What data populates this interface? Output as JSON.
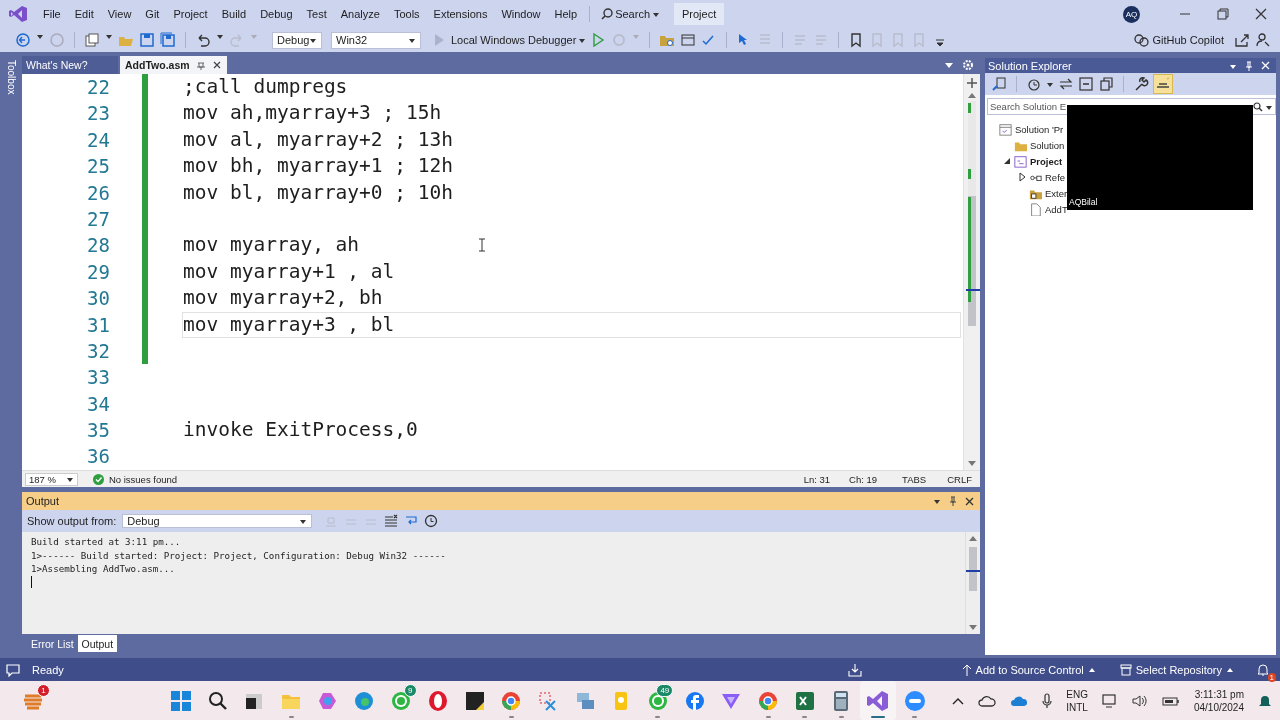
{
  "window": {
    "title": "Project",
    "user_initials": "AQ"
  },
  "menu": [
    "File",
    "Edit",
    "View",
    "Git",
    "Project",
    "Build",
    "Debug",
    "Test",
    "Analyze",
    "Tools",
    "Extensions",
    "Window",
    "Help"
  ],
  "search": {
    "label": "Search"
  },
  "toolbar": {
    "configuration": "Debug",
    "platform": "Win32",
    "debugger": "Local Windows Debugger",
    "copilot": "GitHub Copilot"
  },
  "toolbox": {
    "label": "Toolbox"
  },
  "editor_tabs": [
    {
      "label": "What's New?",
      "selected": false
    },
    {
      "label": "AddTwo.asm",
      "selected": true
    }
  ],
  "code_lines": [
    {
      "number": "22",
      "text": ";call dumpregs",
      "modified": true,
      "current": false
    },
    {
      "number": "23",
      "text": "mov ah,myarray+3 ; 15h",
      "modified": true,
      "current": false
    },
    {
      "number": "24",
      "text": "mov al, myarray+2 ; 13h",
      "modified": true,
      "current": false
    },
    {
      "number": "25",
      "text": "mov bh, myarray+1 ; 12h",
      "modified": true,
      "current": false
    },
    {
      "number": "26",
      "text": "mov bl, myarray+0 ; 10h",
      "modified": true,
      "current": false
    },
    {
      "number": "27",
      "modified": true,
      "current": false
    },
    {
      "number": "28",
      "text": "mov myarray, ah",
      "modified": true,
      "current": false
    },
    {
      "number": "29",
      "text": "mov myarray+1 , al",
      "modified": true,
      "current": false
    },
    {
      "number": "30",
      "text": "mov myarray+2, bh",
      "modified": true,
      "current": false
    },
    {
      "number": "31",
      "text": "mov myarray+3 , bl",
      "modified": true,
      "current": true
    },
    {
      "number": "32",
      "modified": true,
      "current": false
    },
    {
      "number": "33",
      "modified": false,
      "current": false
    },
    {
      "number": "34",
      "modified": false,
      "current": false
    },
    {
      "number": "35",
      "text": "invoke ExitProcess,0",
      "modified": false,
      "current": false
    },
    {
      "number": "36",
      "modified": false,
      "current": false
    }
  ],
  "editor_status": {
    "zoom": "187 %",
    "issues": "No issues found",
    "line": "Ln: 31",
    "column": "Ch: 19",
    "indent": "TABS",
    "line_ending": "CRLF"
  },
  "output": {
    "title": "Output",
    "show_from_label": "Show output from:",
    "source": "Debug",
    "lines": [
      "Build started at 3:11 pm...",
      "1>------ Build started: Project: Project, Configuration: Debug Win32 ------",
      "1>Assembling AddTwo.asm..."
    ]
  },
  "bottom_tabs": [
    {
      "label": "Error List",
      "selected": false
    },
    {
      "label": "Output",
      "selected": true
    }
  ],
  "solution_explorer": {
    "title": "Solution Explorer",
    "search_placeholder": "Search Solution E",
    "tree": [
      {
        "label": "Solution 'Pr",
        "kind": "solution",
        "children": [
          {
            "label": "Solution",
            "kind": "folder"
          },
          {
            "label": "Project",
            "kind": "project",
            "startup": true,
            "expanded": true,
            "children": [
              {
                "label": "Refe",
                "kind": "references",
                "expanded": false
              },
              {
                "label": "Exter",
                "kind": "external"
              },
              {
                "label": "AddT",
                "kind": "file"
              }
            ]
          }
        ]
      }
    ]
  },
  "webcam_overlay": {
    "caption": "AQBilal"
  },
  "status_bar": {
    "status": "Ready",
    "source_control": "Add to Source Control",
    "repository": "Select Repository",
    "notifications_badge": "1"
  },
  "taskbar": {
    "widget_badge": "1",
    "apps": [
      {
        "kind": "start",
        "running": false
      },
      {
        "kind": "search",
        "running": false
      },
      {
        "kind": "taskview",
        "running": false
      },
      {
        "kind": "explorer",
        "running": true
      },
      {
        "kind": "copilot",
        "running": false
      },
      {
        "kind": "edge",
        "running": false
      },
      {
        "kind": "whatsapp",
        "badge": "9",
        "running": false
      },
      {
        "kind": "opera",
        "running": false
      },
      {
        "kind": "notes",
        "running": false
      },
      {
        "kind": "chrome",
        "running": true
      },
      {
        "kind": "snip",
        "running": false
      },
      {
        "kind": "network",
        "running": false
      },
      {
        "kind": "keep",
        "running": false
      },
      {
        "kind": "whatsapp",
        "badge": "49",
        "running": true
      },
      {
        "kind": "facebook",
        "running": false
      },
      {
        "kind": "vpn",
        "running": false
      },
      {
        "kind": "chrome",
        "running": true
      },
      {
        "kind": "excel",
        "running": true
      },
      {
        "kind": "calculator",
        "running": true
      },
      {
        "kind": "visualstudio",
        "running": true,
        "selected": true
      },
      {
        "kind": "zoom",
        "running": true
      }
    ],
    "language": "ENG",
    "layout": "INTL",
    "time": "3:11:31 pm",
    "date": "04/10/2024"
  }
}
